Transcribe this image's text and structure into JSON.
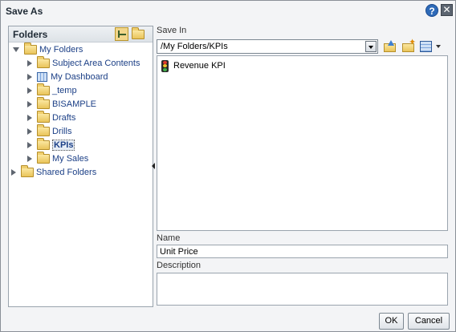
{
  "dialog": {
    "title": "Save As"
  },
  "folders": {
    "title": "Folders",
    "tree": [
      {
        "label": "My Folders",
        "expanded": true,
        "icon": "folder-icon"
      },
      {
        "label": "Subject Area Contents",
        "expanded": false,
        "icon": "folder-icon"
      },
      {
        "label": "My Dashboard",
        "expanded": false,
        "icon": "dashboard-icon"
      },
      {
        "label": "_temp",
        "expanded": false,
        "icon": "folder-icon"
      },
      {
        "label": "BISAMPLE",
        "expanded": false,
        "icon": "folder-icon"
      },
      {
        "label": "Drafts",
        "expanded": false,
        "icon": "folder-icon"
      },
      {
        "label": "Drills",
        "expanded": false,
        "icon": "folder-icon"
      },
      {
        "label": "KPIs",
        "expanded": false,
        "icon": "folder-icon",
        "selected": true
      },
      {
        "label": "My Sales",
        "expanded": false,
        "icon": "folder-icon"
      },
      {
        "label": "Shared Folders",
        "expanded": false,
        "icon": "folder-icon"
      }
    ]
  },
  "save_in": {
    "label": "Save In",
    "path": "/My Folders/KPIs",
    "items": [
      {
        "label": "Revenue KPI",
        "icon": "traffic-light-icon"
      }
    ]
  },
  "name": {
    "label": "Name",
    "value": "Unit Price"
  },
  "description": {
    "label": "Description",
    "value": ""
  },
  "buttons": {
    "ok": "OK",
    "cancel": "Cancel"
  },
  "colors": {
    "link": "#1b3f86",
    "panel_border": "#99a3ad",
    "background": "#f3f4f6"
  }
}
